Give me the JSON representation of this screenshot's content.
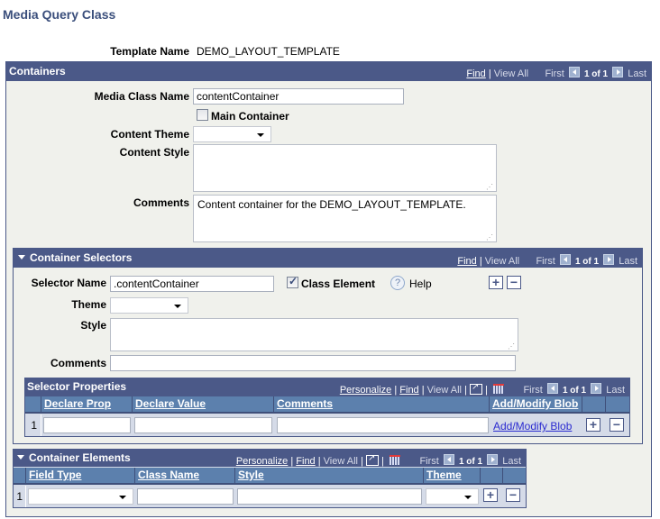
{
  "page": {
    "title": "Media Query Class"
  },
  "template": {
    "label": "Template Name",
    "value": "DEMO_LAYOUT_TEMPLATE"
  },
  "containers": {
    "title": "Containers",
    "nav": {
      "find": "Find",
      "view_all": "View All",
      "first": "First",
      "count": "1 of 1",
      "last": "Last"
    },
    "media_class_name": {
      "label": "Media Class Name",
      "value": "contentContainer"
    },
    "main_container": {
      "label": "Main Container",
      "checked": false
    },
    "content_theme": {
      "label": "Content Theme",
      "value": ""
    },
    "content_style": {
      "label": "Content Style",
      "value": ""
    },
    "comments": {
      "label": "Comments",
      "value": "Content container for the DEMO_LAYOUT_TEMPLATE."
    }
  },
  "selectors": {
    "title": "Container Selectors",
    "nav": {
      "find": "Find",
      "view_all": "View All",
      "first": "First",
      "count": "1 of 1",
      "last": "Last"
    },
    "selector_name": {
      "label": "Selector Name",
      "value": ".contentContainer"
    },
    "class_element": {
      "label": "Class Element",
      "checked": true
    },
    "help": {
      "label": "Help",
      "icon": "?"
    },
    "theme": {
      "label": "Theme",
      "value": ""
    },
    "style": {
      "label": "Style",
      "value": ""
    },
    "comments": {
      "label": "Comments",
      "value": ""
    },
    "add": "+",
    "remove": "−"
  },
  "selector_properties": {
    "title": "Selector Properties",
    "nav": {
      "personalize": "Personalize",
      "find": "Find",
      "view_all": "View All",
      "first": "First",
      "count": "1 of 1",
      "last": "Last"
    },
    "columns": [
      "Declare Prop",
      "Declare Value",
      "Comments",
      "Add/Modify Blob"
    ],
    "rows": [
      {
        "num": "1",
        "declare_prop": "",
        "declare_value": "",
        "comments": "",
        "blob_link": "Add/Modify Blob"
      }
    ],
    "add": "+",
    "remove": "−"
  },
  "elements": {
    "title": "Container Elements",
    "nav": {
      "personalize": "Personalize",
      "find": "Find",
      "view_all": "View All",
      "first": "First",
      "count": "1 of 1",
      "last": "Last"
    },
    "columns": [
      "Field Type",
      "Class Name",
      "Style",
      "Theme"
    ],
    "rows": [
      {
        "num": "1",
        "field_type": "",
        "class_name": "",
        "style": "",
        "theme": ""
      }
    ],
    "add": "+",
    "remove": "−"
  },
  "colors": {
    "header": "#4b5988",
    "grid_header": "#5c80ad",
    "panel": "#f0f1ec",
    "title": "#3b4f7c",
    "link": "#2b2bd0"
  }
}
